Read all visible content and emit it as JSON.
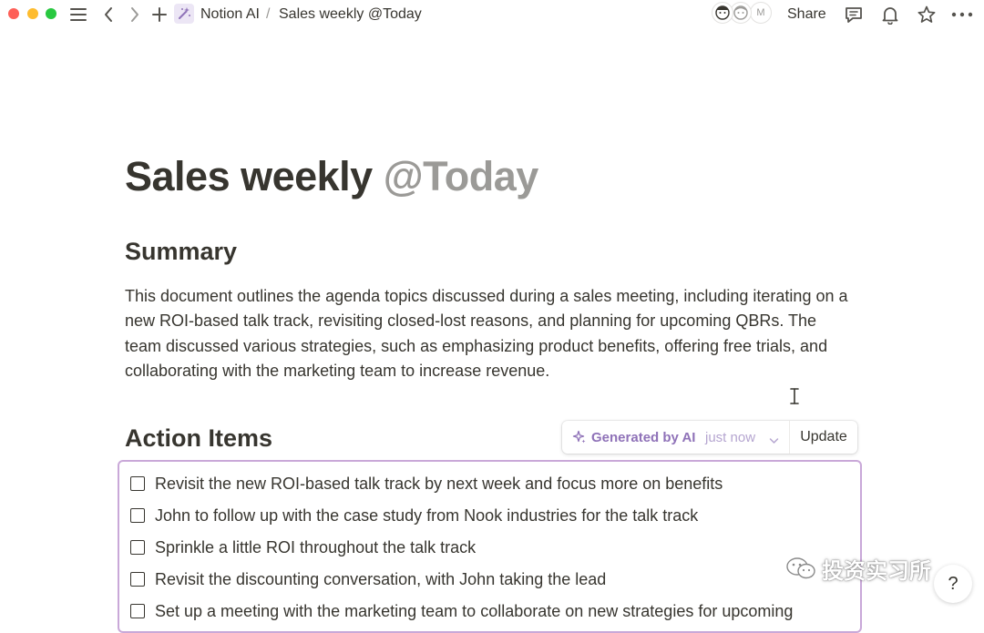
{
  "topbar": {
    "breadcrumb_parent": "Notion AI",
    "breadcrumb_separator": "/",
    "breadcrumb_current": "Sales weekly @Today",
    "avatar_initial": "M",
    "share_label": "Share",
    "icons": [
      "menu-icon",
      "back-icon",
      "forward-icon",
      "plus-icon",
      "magic-wand-icon",
      "comment-icon",
      "bell-icon",
      "star-icon",
      "more-icon"
    ]
  },
  "page": {
    "title_main": "Sales weekly",
    "title_mention": "@Today",
    "summary_heading": "Summary",
    "summary_text": "This document outlines the agenda topics discussed during a sales meeting, including iterating on a new ROI-based talk track, revisiting closed-lost reasons, and planning for upcoming QBRs. The team discussed various strategies, such as emphasizing product benefits, offering free trials, and collaborating with the marketing team to increase revenue.",
    "action_heading": "Action Items"
  },
  "ai_block": {
    "generated_label": "Generated by AI",
    "generated_time": "just now",
    "update_label": "Update",
    "accent_color": "#8f72b8",
    "border_color": "#c9a8d8"
  },
  "todos": [
    {
      "text": "Revisit the new ROI-based talk track by next week and focus more on benefits",
      "checked": false
    },
    {
      "text": "John to follow up with the case study from Nook industries for the talk track",
      "checked": false
    },
    {
      "text": "Sprinkle a little ROI throughout the talk track",
      "checked": false
    },
    {
      "text": "Revisit the discounting conversation, with John taking the lead",
      "checked": false
    },
    {
      "text": "Set up a meeting with the marketing team to collaborate on new strategies for upcoming",
      "checked": false
    }
  ],
  "watermark": {
    "text": "投资实习所"
  },
  "help": {
    "label": "?"
  }
}
